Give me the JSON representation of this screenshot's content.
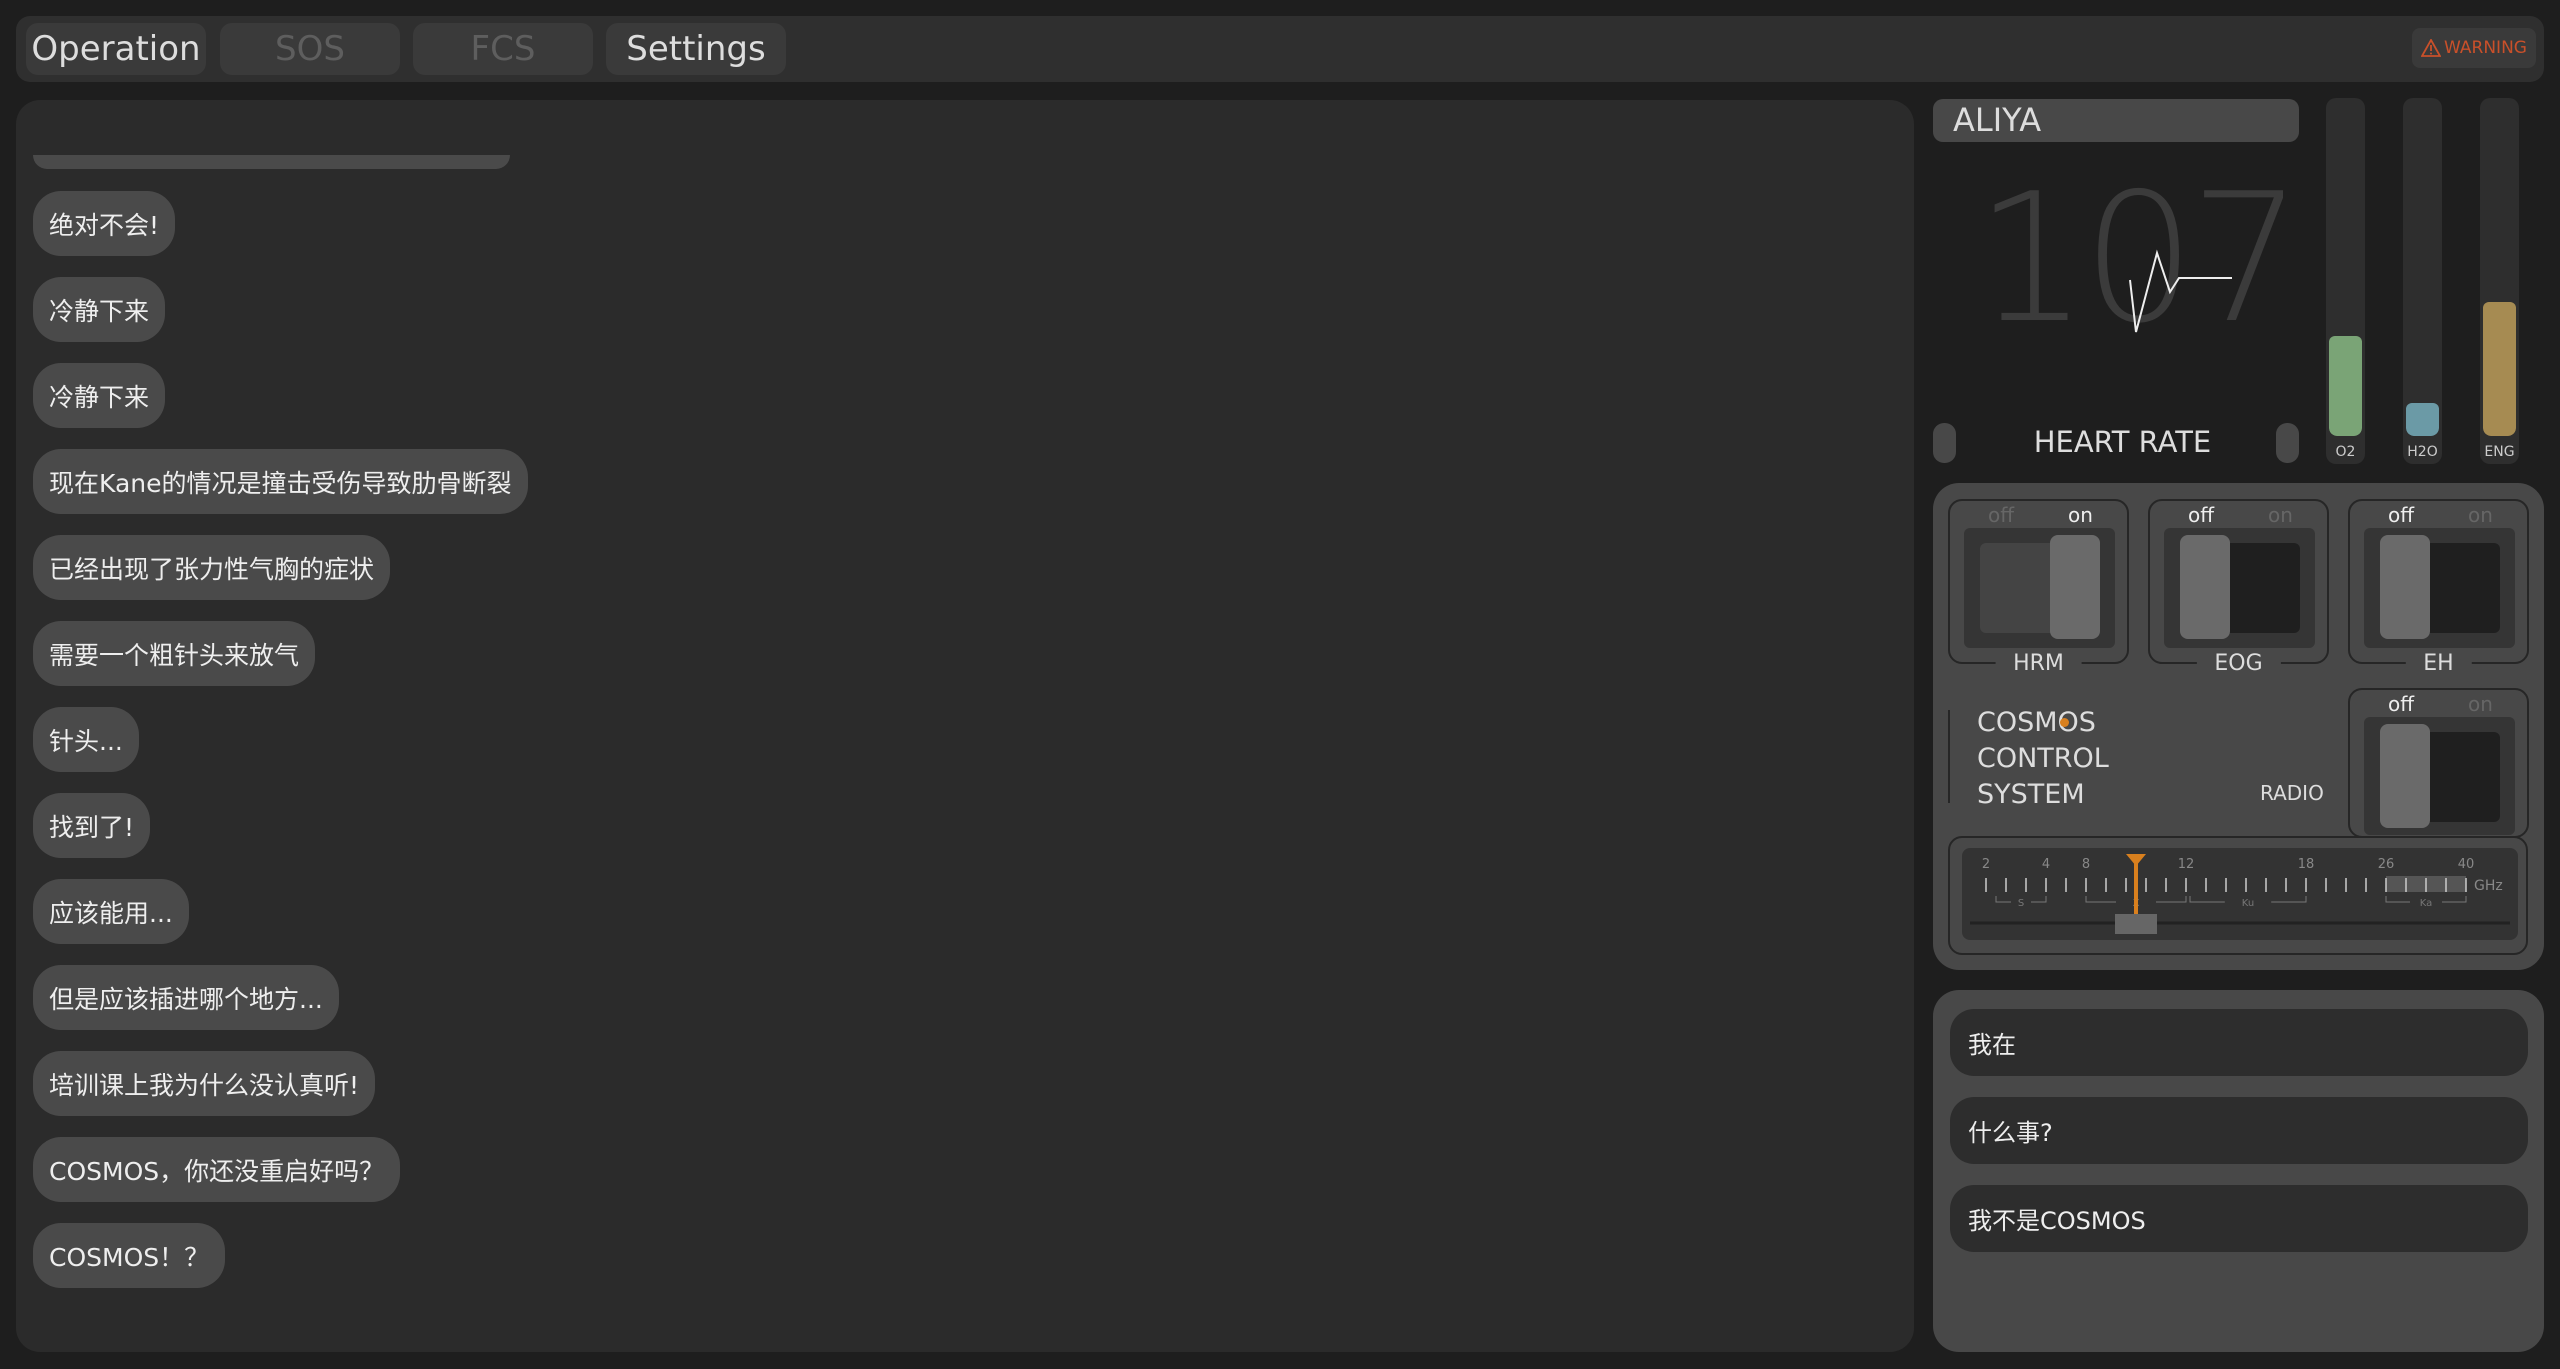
{
  "tabs": [
    {
      "label": "Operation",
      "enabled": true
    },
    {
      "label": "SOS",
      "enabled": false
    },
    {
      "label": "FCS",
      "enabled": false
    },
    {
      "label": "Settings",
      "enabled": true
    }
  ],
  "warning": {
    "icon": "warning-triangle-icon",
    "label": "WARNING",
    "color": "#c9502a"
  },
  "chat": {
    "messages": [
      "绝对不会!",
      "冷静下来",
      "冷静下来",
      "现在Kane的情况是撞击受伤导致肋骨断裂",
      "已经出现了张力性气胸的症状",
      "需要一个粗针头来放气",
      "针头...",
      "找到了!",
      "应该能用...",
      "但是应该插进哪个地方...",
      "培训课上我为什么没认真听!",
      "COSMOS，你还没重启好吗？",
      "COSMOS！？"
    ]
  },
  "vitals": {
    "name": "ALIYA",
    "heart_rate": "107",
    "heart_rate_label": "HEART RATE",
    "gauges": [
      {
        "label": "O2",
        "level": 0.3,
        "color": "#7aa476"
      },
      {
        "label": "H2O",
        "level": 0.1,
        "color": "#6b9aa6"
      },
      {
        "label": "ENG",
        "level": 0.4,
        "color": "#a68b52"
      }
    ]
  },
  "controls": {
    "off_label": "off",
    "on_label": "on",
    "switches": [
      {
        "name": "HRM",
        "on": true
      },
      {
        "name": "EOG",
        "on": false
      },
      {
        "name": "EH",
        "on": false
      }
    ],
    "system_title": [
      "COSMOS",
      "CONTROL",
      "SYSTEM"
    ],
    "status_dot_color": "#d9801e",
    "radio": {
      "label": "RADIO",
      "on": false,
      "dial": {
        "unit": "GHz",
        "tick_labels": [
          "2",
          "4",
          "8",
          "12",
          "18",
          "26",
          "40"
        ],
        "bands": [
          "S",
          "X",
          "Ku",
          "Ka"
        ],
        "needle_ghz": 10,
        "needle_color": "#d9801e"
      }
    }
  },
  "responses": [
    "我在",
    "什么事?",
    "我不是COSMOS"
  ]
}
